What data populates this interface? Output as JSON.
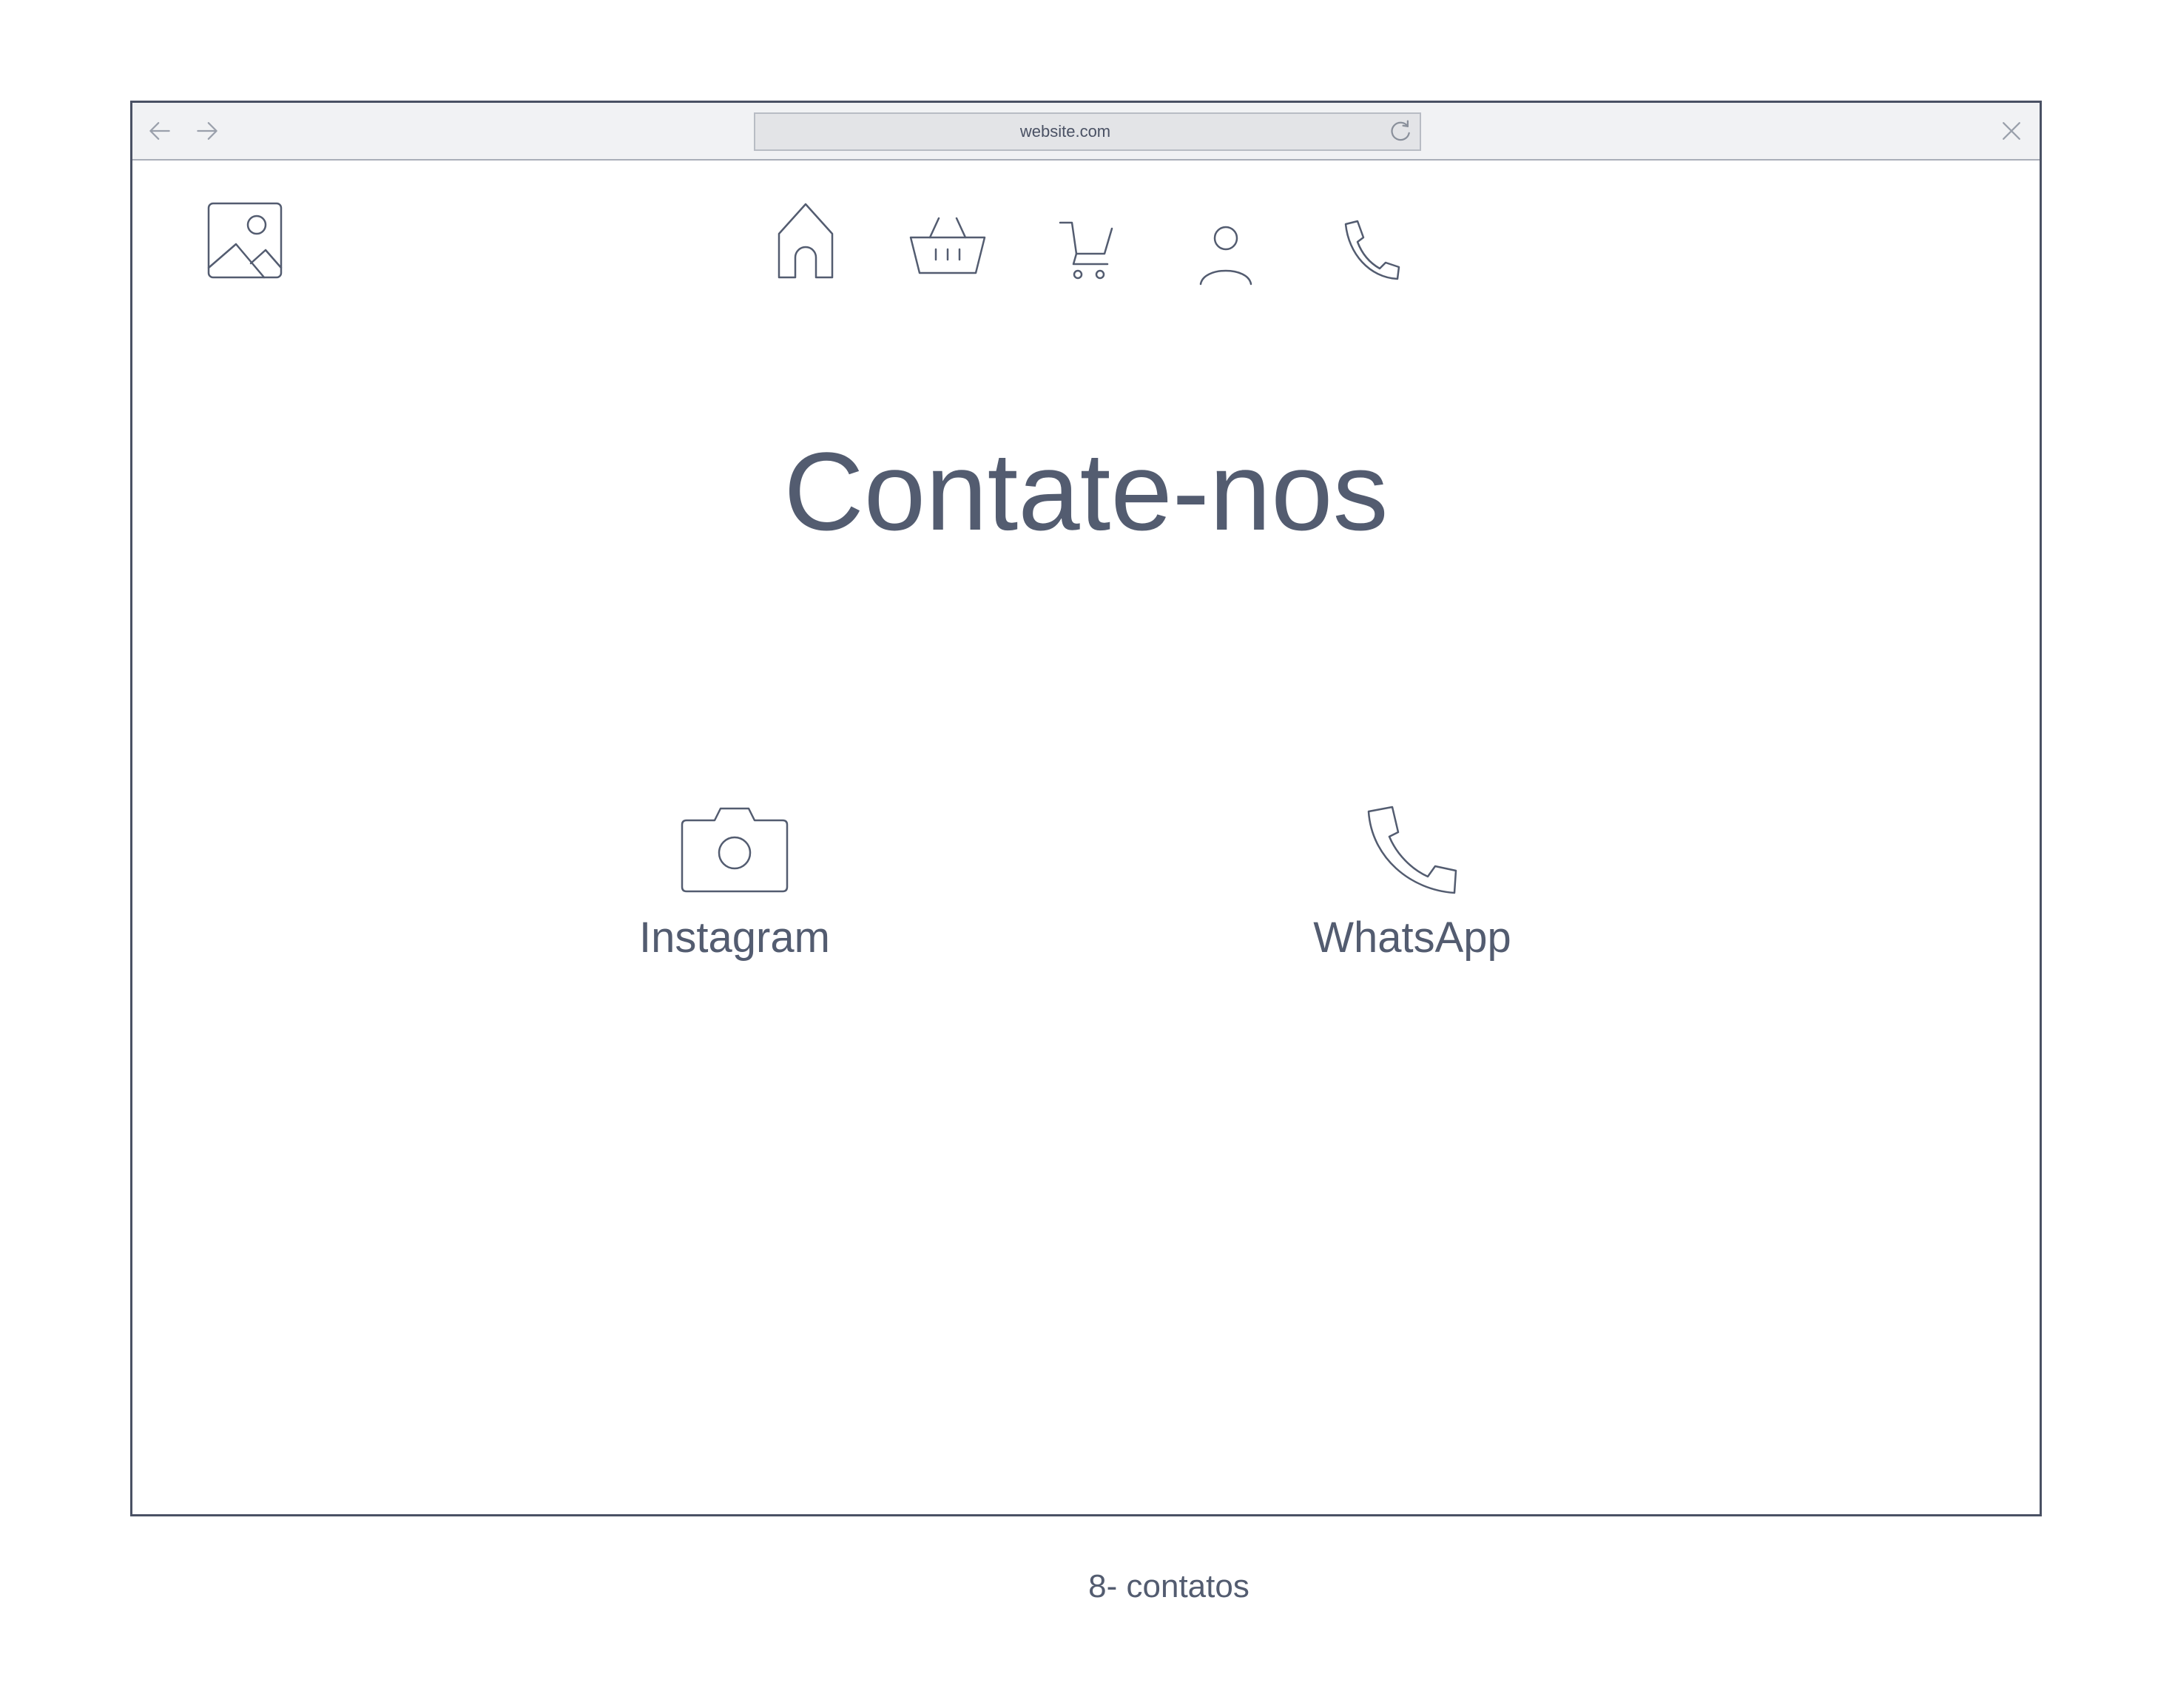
{
  "browser": {
    "url": "website.com",
    "back_icon": "arrow-left-icon",
    "forward_icon": "arrow-right-icon",
    "reload_icon": "reload-icon",
    "close_icon": "close-icon"
  },
  "header": {
    "logo_icon": "image-placeholder-icon",
    "nav": [
      {
        "name": "home",
        "icon": "home-icon"
      },
      {
        "name": "basket",
        "icon": "basket-icon"
      },
      {
        "name": "cart",
        "icon": "cart-icon"
      },
      {
        "name": "user",
        "icon": "user-icon"
      },
      {
        "name": "phone",
        "icon": "phone-icon"
      }
    ]
  },
  "main": {
    "title": "Contate-nos",
    "contacts": [
      {
        "label": "Instagram",
        "icon": "camera-icon"
      },
      {
        "label": "WhatsApp",
        "icon": "phone-icon"
      }
    ]
  },
  "caption": "8- contatos",
  "colors": {
    "text": "#535c70",
    "frame": "#4a5164",
    "chrome_bg": "#f1f2f4",
    "url_bg": "#e3e4e7"
  }
}
